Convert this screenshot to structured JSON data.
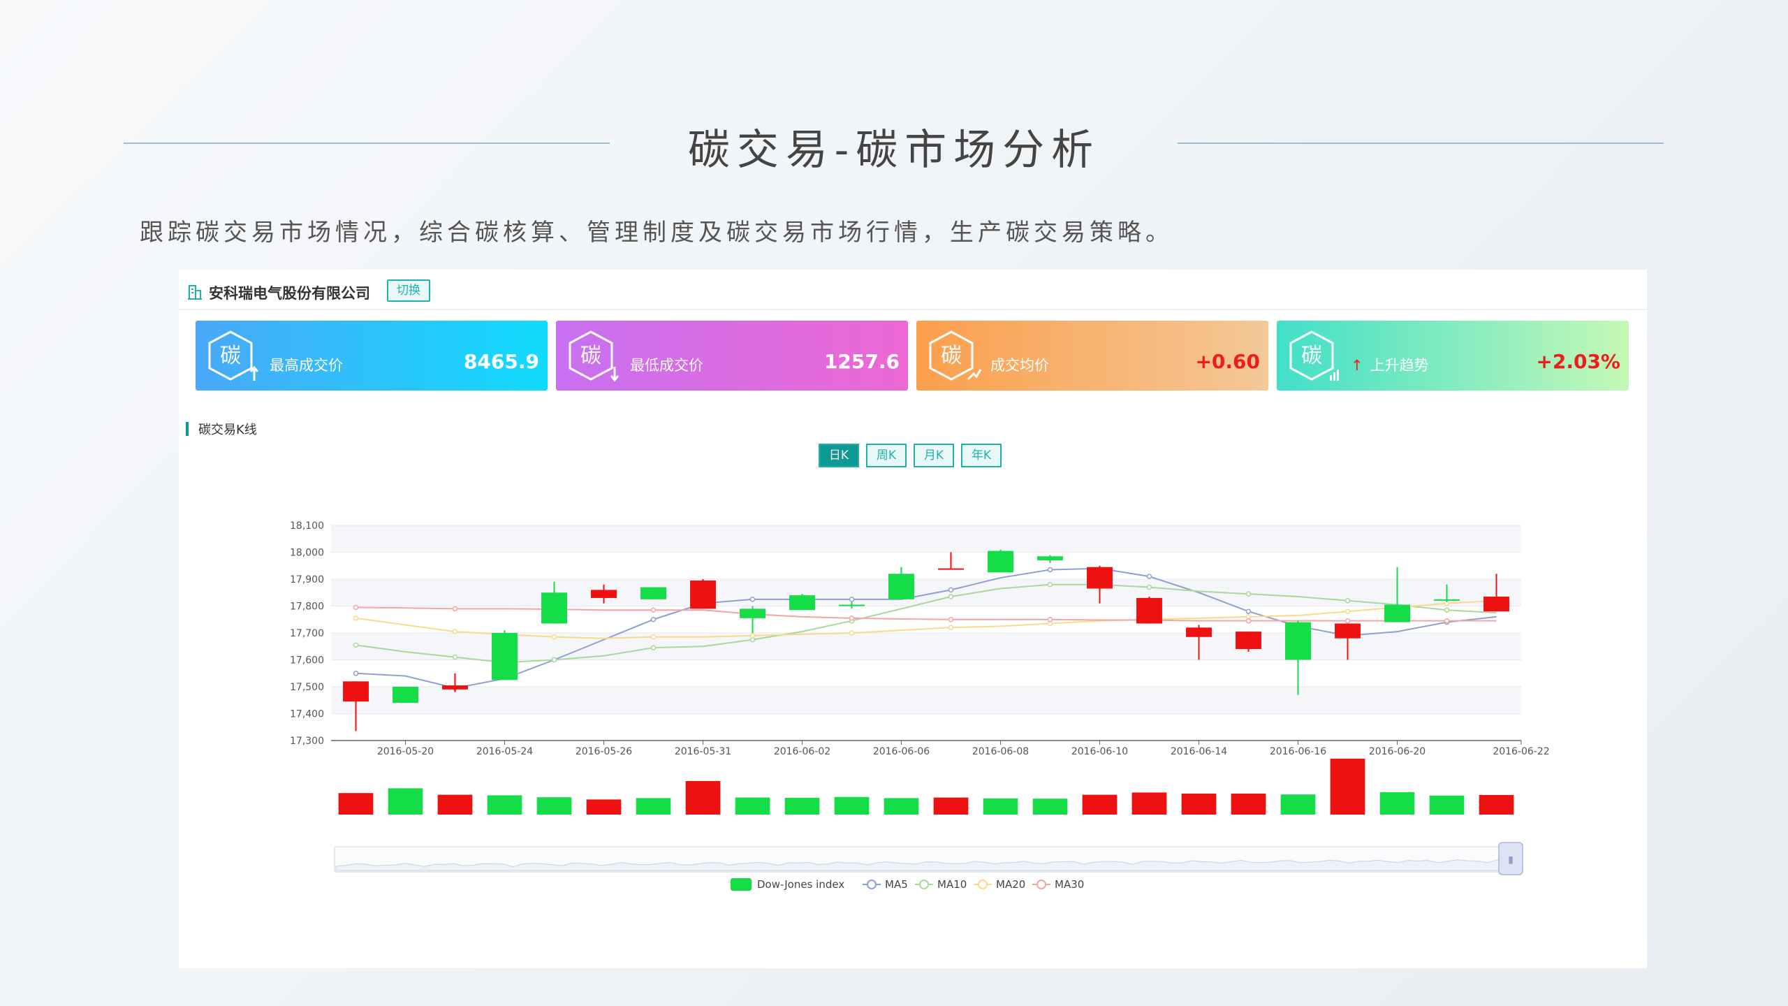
{
  "page": {
    "title": "碳交易-碳市场分析",
    "subtitle": "跟踪碳交易市场情况，综合碳核算、管理制度及碳交易市场行情，生产碳交易策略。"
  },
  "company": {
    "name": "安科瑞电气股份有限公司",
    "switch_label": "切换",
    "icon": "building-icon"
  },
  "cards": [
    {
      "label": "最高成交价",
      "value": "8465.9",
      "icon": "carbon-up-icon"
    },
    {
      "label": "最低成交价",
      "value": "1257.6",
      "icon": "carbon-down-icon"
    },
    {
      "label": "成交均价",
      "value": "+0.60",
      "icon": "carbon-avg-icon"
    },
    {
      "label": "上升趋势",
      "arrow": "↑",
      "value": "+2.03%",
      "icon": "carbon-trend-icon"
    }
  ],
  "kline": {
    "title": "碳交易K线",
    "tabs": [
      "日K",
      "周K",
      "月K",
      "年K"
    ],
    "active_tab": "日K"
  },
  "colors": {
    "up": "#ee1111",
    "down": "#14dd48",
    "accent": "#20b2aa",
    "ma5": "#8f9fd6",
    "ma10": "#a8d99a",
    "ma20": "#f9d98a",
    "ma30": "#f4a4a4"
  },
  "chart_data": {
    "type": "candlestick",
    "ylim": [
      17300,
      18100
    ],
    "yticks": [
      "17,300",
      "17,400",
      "17,500",
      "17,600",
      "17,700",
      "17,800",
      "17,900",
      "18,000",
      "18,100"
    ],
    "xtick_labels": [
      "2016-05-20",
      "2016-05-24",
      "2016-05-26",
      "2016-05-31",
      "2016-06-02",
      "2016-06-06",
      "2016-06-08",
      "2016-06-10",
      "2016-06-14",
      "2016-06-16",
      "2016-06-20",
      "2016-06-22"
    ],
    "candles": [
      {
        "open": 17445,
        "close": 17520,
        "low": 17335,
        "high": 17520
      },
      {
        "open": 17500,
        "close": 17440,
        "low": 17440,
        "high": 17500
      },
      {
        "open": 17490,
        "close": 17505,
        "low": 17480,
        "high": 17550
      },
      {
        "open": 17700,
        "close": 17525,
        "low": 17525,
        "high": 17710
      },
      {
        "open": 17850,
        "close": 17735,
        "low": 17735,
        "high": 17890
      },
      {
        "open": 17830,
        "close": 17860,
        "low": 17810,
        "high": 17880
      },
      {
        "open": 17870,
        "close": 17825,
        "low": 17825,
        "high": 17870
      },
      {
        "open": 17790,
        "close": 17895,
        "low": 17790,
        "high": 17900
      },
      {
        "open": 17790,
        "close": 17755,
        "low": 17700,
        "high": 17800
      },
      {
        "open": 17840,
        "close": 17785,
        "low": 17785,
        "high": 17845
      },
      {
        "open": 17805,
        "close": 17800,
        "low": 17790,
        "high": 17815
      },
      {
        "open": 17920,
        "close": 17825,
        "low": 17825,
        "high": 17945
      },
      {
        "open": 17940,
        "close": 17940,
        "low": 17940,
        "high": 18000
      },
      {
        "open": 18005,
        "close": 17925,
        "low": 17925,
        "high": 18010
      },
      {
        "open": 17985,
        "close": 17970,
        "low": 17960,
        "high": 17990
      },
      {
        "open": 17865,
        "close": 17945,
        "low": 17810,
        "high": 17950
      },
      {
        "open": 17735,
        "close": 17830,
        "low": 17735,
        "high": 17835
      },
      {
        "open": 17685,
        "close": 17720,
        "low": 17600,
        "high": 17730
      },
      {
        "open": 17640,
        "close": 17705,
        "low": 17630,
        "high": 17705
      },
      {
        "open": 17740,
        "close": 17600,
        "low": 17470,
        "high": 17745
      },
      {
        "open": 17680,
        "close": 17735,
        "low": 17600,
        "high": 17735
      },
      {
        "open": 17805,
        "close": 17740,
        "low": 17740,
        "high": 17945
      },
      {
        "open": 17825,
        "close": 17820,
        "low": 17815,
        "high": 17880
      },
      {
        "open": 17780,
        "close": 17835,
        "low": 17780,
        "high": 17920
      }
    ],
    "volume": [
      77,
      94,
      71,
      69,
      62,
      54,
      59,
      120,
      61,
      60,
      63,
      59,
      61,
      58,
      57,
      71,
      79,
      75,
      75,
      72,
      200,
      80,
      68,
      70
    ],
    "ma": [
      {
        "name": "MA5",
        "values": [
          17550,
          17540,
          17495,
          17530,
          17600,
          17675,
          17750,
          17810,
          17825,
          17825,
          17825,
          17825,
          17860,
          17905,
          17935,
          17940,
          17910,
          17850,
          17780,
          17725,
          17690,
          17705,
          17740,
          17760
        ]
      },
      {
        "name": "MA10",
        "values": [
          17655,
          17630,
          17610,
          17590,
          17600,
          17615,
          17645,
          17650,
          17675,
          17705,
          17745,
          17790,
          17835,
          17865,
          17880,
          17880,
          17870,
          17855,
          17845,
          17835,
          17820,
          17805,
          17785,
          17775
        ]
      },
      {
        "name": "MA20",
        "values": [
          17755,
          17730,
          17705,
          17695,
          17685,
          17680,
          17685,
          17685,
          17690,
          17695,
          17700,
          17710,
          17720,
          17725,
          17735,
          17745,
          17750,
          17755,
          17760,
          17765,
          17780,
          17795,
          17810,
          17820
        ]
      },
      {
        "name": "MA30",
        "values": [
          17795,
          17793,
          17790,
          17790,
          17788,
          17785,
          17785,
          17785,
          17770,
          17760,
          17755,
          17752,
          17750,
          17750,
          17750,
          17748,
          17748,
          17745,
          17745,
          17745,
          17745,
          17745,
          17745,
          17745
        ]
      }
    ],
    "legend": [
      "Dow-Jones index",
      "MA5",
      "MA10",
      "MA20",
      "MA30"
    ],
    "legend_position": "bottom",
    "datazoom_handle": "▮"
  }
}
